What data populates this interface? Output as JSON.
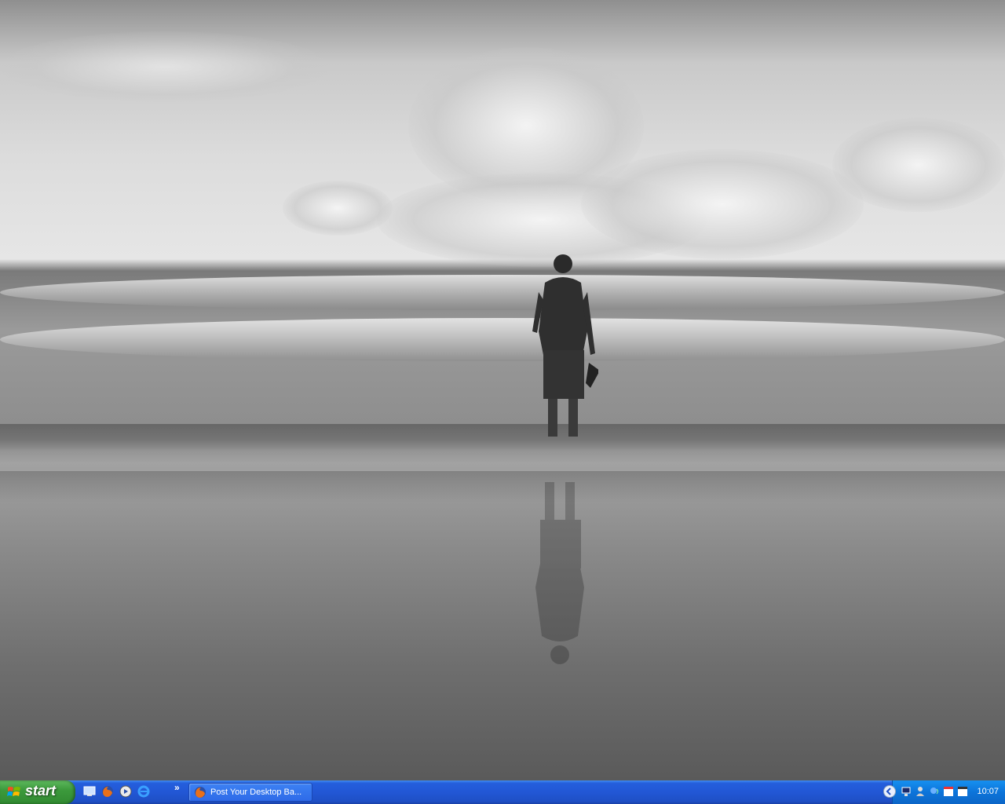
{
  "desktop": {
    "wallpaper": "black-and-white beach photo of a man standing in the surf"
  },
  "taskbar": {
    "start_label": "start",
    "quicklaunch_icons": [
      "desktop-icon",
      "firefox-icon",
      "media-player-icon",
      "internet-explorer-icon"
    ],
    "quicklaunch_overflow": "»",
    "tasks": [
      {
        "label": "Post Your Desktop Ba...",
        "icon": "firefox-icon"
      }
    ],
    "tray": {
      "icons": [
        "network-icon",
        "user-icon",
        "messenger-icon",
        "calendar-icon",
        "calendar-icon"
      ],
      "time": "10:07"
    },
    "colors": {
      "bar": "#245edc",
      "start": "#3c9a3c",
      "tray": "#0c74da"
    }
  }
}
